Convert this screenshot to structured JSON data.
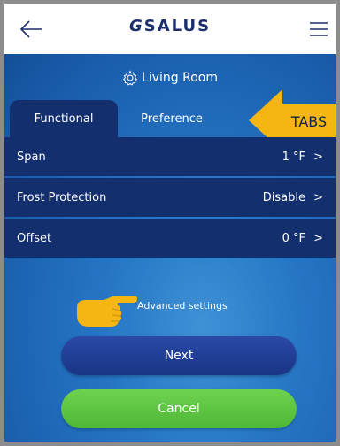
{
  "header": {
    "logo_text": "SALUS",
    "back_icon": "arrow-left-icon",
    "menu_icon": "hamburger-menu-icon"
  },
  "room": {
    "name": "Living Room",
    "icon": "gear-icon"
  },
  "tabs": [
    {
      "label": "Functional",
      "active": true
    },
    {
      "label": "Preference",
      "active": false
    }
  ],
  "annotation": {
    "tabs_label": "TABS",
    "color": "#f5b512"
  },
  "settings": [
    {
      "label": "Span",
      "value": "1 °F"
    },
    {
      "label": "Frost Protection",
      "value": "Disable"
    },
    {
      "label": "Offset",
      "value": "0 °F"
    }
  ],
  "advanced_link": "Advanced settings",
  "buttons": {
    "next": "Next",
    "cancel": "Cancel"
  },
  "colors": {
    "row_bg": "#132f6e",
    "next_button": "#2a4aa6",
    "cancel_button": "#5ec443",
    "screen_bg": "#2676c5"
  }
}
